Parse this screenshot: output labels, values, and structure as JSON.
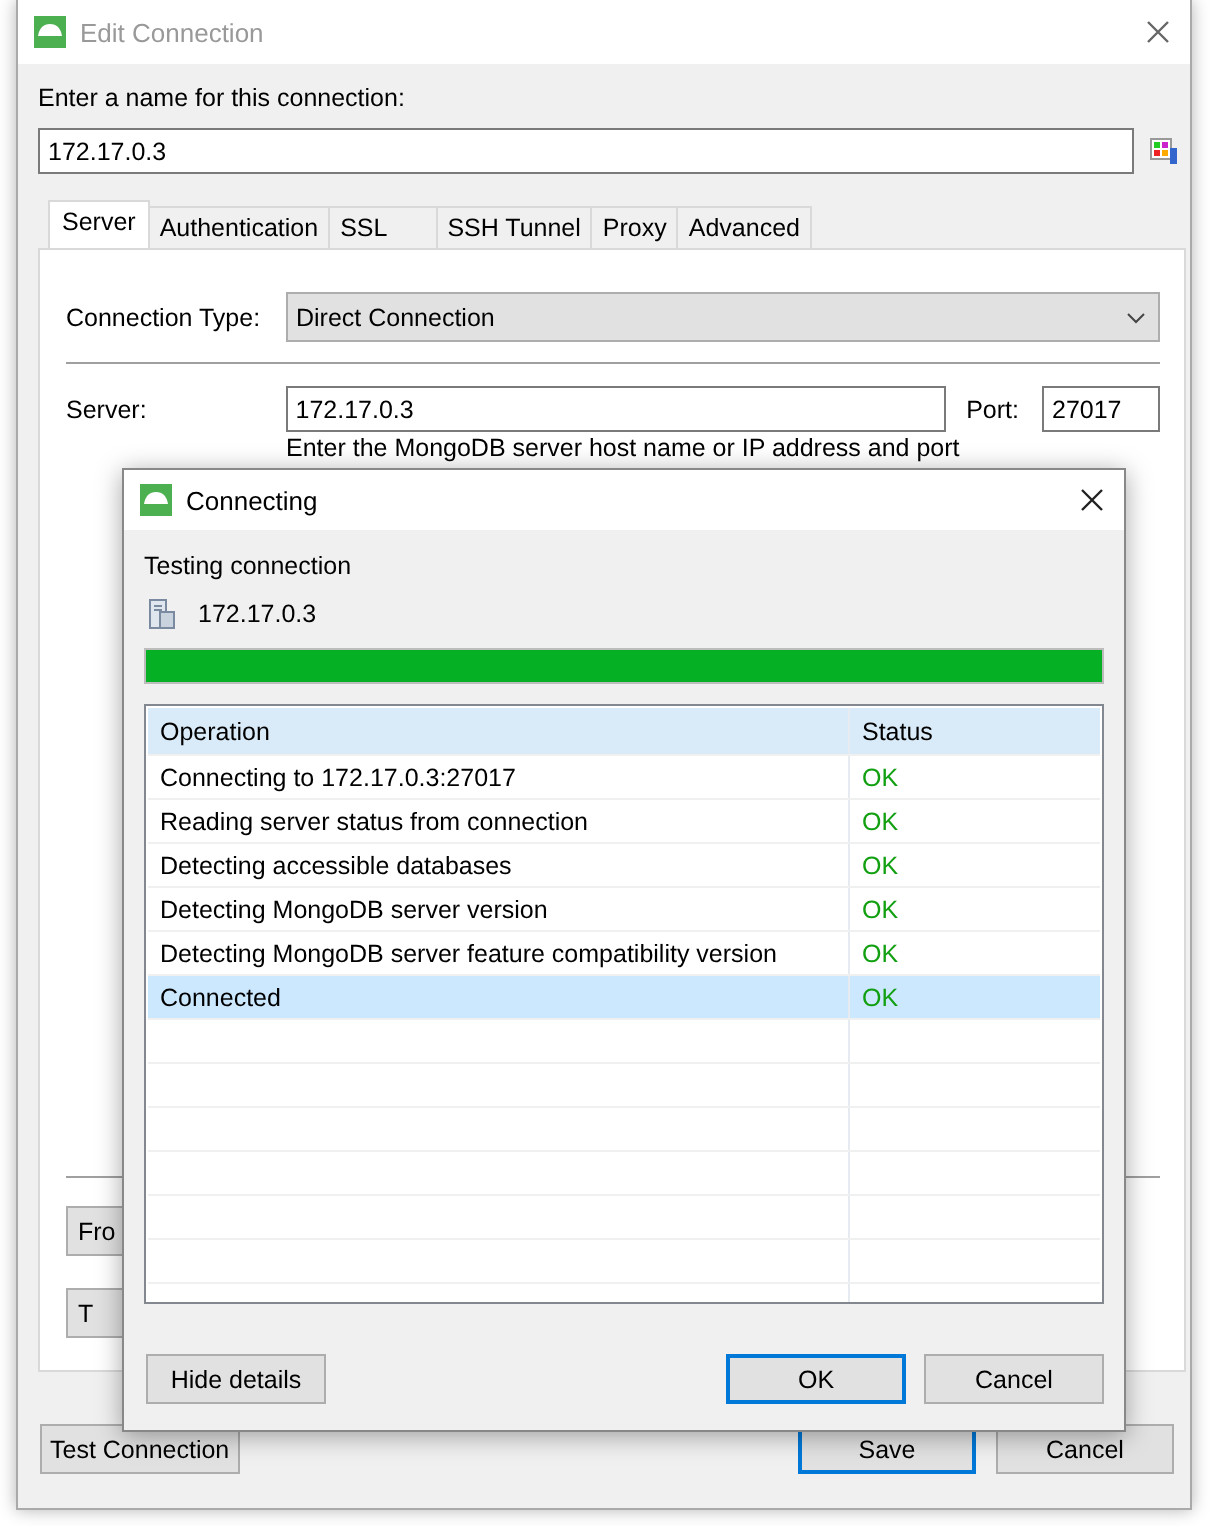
{
  "window": {
    "title": "Edit Connection"
  },
  "name_label": "Enter a name for this connection:",
  "name_value": "172.17.0.3",
  "tabs": [
    {
      "label": "Server",
      "selected": true
    },
    {
      "label": "Authentication",
      "selected": false
    },
    {
      "label": "SSL",
      "selected": false
    },
    {
      "label": "SSH Tunnel",
      "selected": false
    },
    {
      "label": "Proxy",
      "selected": false
    },
    {
      "label": "Advanced",
      "selected": false
    }
  ],
  "server_tab": {
    "connection_type_label": "Connection Type:",
    "connection_type": "Direct Connection",
    "server_label": "Server:",
    "server": "172.17.0.3",
    "port_label": "Port:",
    "port": "27017",
    "hint": "Enter the MongoDB server host name or IP address and port",
    "buttons": [
      "Fro",
      "T"
    ]
  },
  "footer_buttons": [
    {
      "label": "Test Connection",
      "kind": "plain"
    },
    {
      "label": "Save",
      "kind": "default"
    },
    {
      "label": "Cancel",
      "kind": "plain"
    }
  ],
  "dialog": {
    "title": "Connecting",
    "heading": "Testing connection",
    "server": "172.17.0.3",
    "progress": {
      "level": 1
    },
    "table": {
      "columns": [
        "Operation",
        "Status"
      ],
      "rows": [
        {
          "operation": "Connecting to 172.17.0.3:27017",
          "status": "OK",
          "selected": false
        },
        {
          "operation": "Reading server status from connection",
          "status": "OK",
          "selected": false
        },
        {
          "operation": "Detecting accessible databases",
          "status": "OK",
          "selected": false
        },
        {
          "operation": "Detecting MongoDB server version",
          "status": "OK",
          "selected": false
        },
        {
          "operation": "Detecting MongoDB server feature compatibility version",
          "status": "OK",
          "selected": false
        },
        {
          "operation": "Connected",
          "status": "OK",
          "selected": true
        }
      ]
    },
    "buttons": [
      {
        "label": "Hide details",
        "kind": "plain"
      },
      {
        "label": "OK",
        "kind": "default"
      },
      {
        "label": "Cancel",
        "kind": "plain"
      }
    ]
  }
}
